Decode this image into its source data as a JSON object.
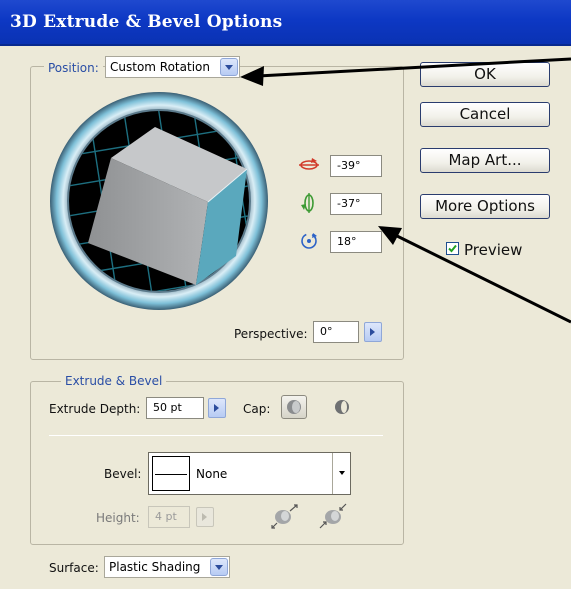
{
  "window": {
    "title": "3D Extrude & Bevel Options"
  },
  "position": {
    "legend_label": "Position:",
    "selected": "Custom Rotation",
    "x_rotation": "-39°",
    "y_rotation": "-37°",
    "z_rotation": "18°",
    "perspective_label": "Perspective:",
    "perspective_value": "0°"
  },
  "buttons": {
    "ok": "OK",
    "cancel": "Cancel",
    "map_art": "Map Art...",
    "more_options": "More Options"
  },
  "preview": {
    "label": "Preview",
    "checked": true
  },
  "extrude": {
    "legend": "Extrude & Bevel",
    "depth_label": "Extrude Depth:",
    "depth_value": "50 pt",
    "cap_label": "Cap:",
    "bevel_label": "Bevel:",
    "bevel_value": "None",
    "height_label": "Height:",
    "height_value": "4 pt"
  },
  "surface": {
    "label": "Surface:",
    "value": "Plastic Shading"
  },
  "icons": {
    "x_axis": "rotate-x-icon",
    "y_axis": "rotate-y-icon",
    "z_axis": "rotate-z-icon",
    "cap_on": "cap-on-icon",
    "cap_off": "cap-off-icon",
    "bevel_out": "bevel-extent-out-icon",
    "bevel_in": "bevel-extent-in-icon"
  },
  "colors": {
    "title_bar": "#0d38c4",
    "dialog_bg": "#ece9d8",
    "legend_text": "#2a4ea5",
    "cube_side": "#5aa8bd",
    "cube_top": "#c9cacb"
  }
}
